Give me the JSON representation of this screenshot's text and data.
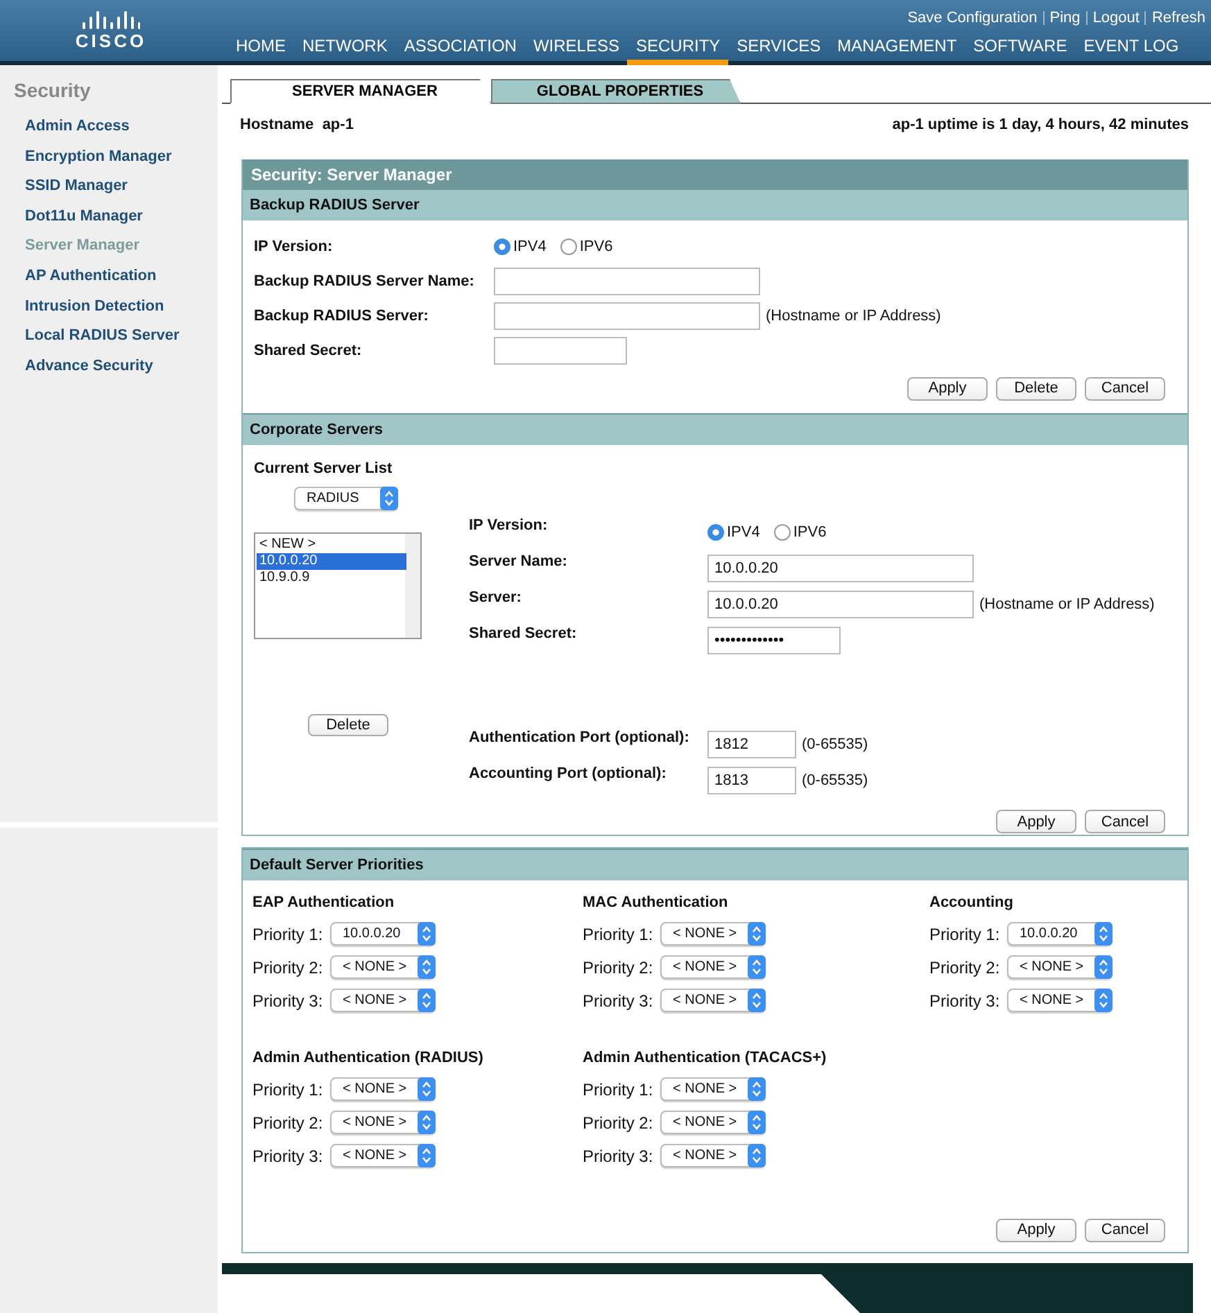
{
  "header": {
    "logo": "CISCO",
    "top_links": [
      {
        "label": "Save Configuration"
      },
      {
        "label": "Ping"
      },
      {
        "label": "Logout"
      },
      {
        "label": "Refresh"
      }
    ],
    "nav": [
      {
        "label": "HOME",
        "selected": false
      },
      {
        "label": "NETWORK",
        "selected": false
      },
      {
        "label": "ASSOCIATION",
        "selected": false
      },
      {
        "label": "WIRELESS",
        "selected": false
      },
      {
        "label": "SECURITY",
        "selected": true
      },
      {
        "label": "SERVICES",
        "selected": false
      },
      {
        "label": "MANAGEMENT",
        "selected": false
      },
      {
        "label": "SOFTWARE",
        "selected": false
      },
      {
        "label": "EVENT LOG",
        "selected": false
      }
    ]
  },
  "sidebar": {
    "title": "Security",
    "items": [
      {
        "label": "Admin Access",
        "selected": false
      },
      {
        "label": "Encryption Manager",
        "selected": false
      },
      {
        "label": "SSID Manager",
        "selected": false
      },
      {
        "label": "Dot11u Manager",
        "selected": false
      },
      {
        "label": "Server Manager",
        "selected": true
      },
      {
        "label": "AP Authentication",
        "selected": false
      },
      {
        "label": "Intrusion Detection",
        "selected": false
      },
      {
        "label": "Local RADIUS Server",
        "selected": false
      },
      {
        "label": "Advance Security",
        "selected": false
      }
    ]
  },
  "tabs": [
    {
      "label": "SERVER MANAGER",
      "selected": true
    },
    {
      "label": "GLOBAL PROPERTIES",
      "selected": false
    }
  ],
  "hostname": {
    "label": "Hostname",
    "value": "ap-1"
  },
  "uptime": "ap-1 uptime is 1 day, 4 hours, 42 minutes",
  "page_title": "Security: Server Manager",
  "backup": {
    "title": "Backup RADIUS Server",
    "ip_version": {
      "label": "IP Version:",
      "options": [
        {
          "label": "IPV4",
          "selected": true
        },
        {
          "label": "IPV6",
          "selected": false
        }
      ]
    },
    "fields": [
      {
        "label": "Backup RADIUS Server Name:",
        "kind": "wide"
      },
      {
        "label": "Backup RADIUS Server:",
        "kind": "wide",
        "hint": "(Hostname or IP Address)"
      },
      {
        "label": "Shared Secret:",
        "kind": "narrow"
      }
    ],
    "buttons": [
      "Apply",
      "Delete",
      "Cancel"
    ]
  },
  "corporate": {
    "title": "Corporate Servers",
    "list_label": "Current Server List",
    "server_type": "RADIUS",
    "servers": [
      {
        "label": "< NEW >",
        "selected": false
      },
      {
        "label": "10.0.0.20",
        "selected": true
      },
      {
        "label": "10.9.0.9",
        "selected": false
      }
    ],
    "delete_button": "Delete",
    "ip_version": {
      "label": "IP Version:",
      "options": [
        {
          "label": "IPV4",
          "selected": true
        },
        {
          "label": "IPV6",
          "selected": false
        }
      ]
    },
    "fields": [
      {
        "label": "Server Name:",
        "value": "10.0.0.20",
        "kind": "wide"
      },
      {
        "label": "Server:",
        "value": "10.0.0.20",
        "kind": "wide",
        "hint": "(Hostname or IP Address)"
      },
      {
        "label": "Shared Secret:",
        "value": "•••••••••••••",
        "kind": "narrow"
      }
    ],
    "ports": [
      {
        "label": "Authentication Port (optional):",
        "value": "1812",
        "hint": "(0-65535)"
      },
      {
        "label": "Accounting Port (optional):",
        "value": "1813",
        "hint": "(0-65535)"
      }
    ],
    "buttons": [
      "Apply",
      "Cancel"
    ]
  },
  "priorities": {
    "title": "Default Server Priorities",
    "groups": [
      {
        "title": "EAP Authentication",
        "rows": [
          {
            "label": "Priority 1:",
            "value": "10.0.0.20"
          },
          {
            "label": "Priority 2:",
            "value": "< NONE >"
          },
          {
            "label": "Priority 3:",
            "value": "< NONE >"
          }
        ]
      },
      {
        "title": "MAC Authentication",
        "rows": [
          {
            "label": "Priority 1:",
            "value": "< NONE >"
          },
          {
            "label": "Priority 2:",
            "value": "< NONE >"
          },
          {
            "label": "Priority 3:",
            "value": "< NONE >"
          }
        ]
      },
      {
        "title": "Accounting",
        "rows": [
          {
            "label": "Priority 1:",
            "value": "10.0.0.20"
          },
          {
            "label": "Priority 2:",
            "value": "< NONE >"
          },
          {
            "label": "Priority 3:",
            "value": "< NONE >"
          }
        ]
      },
      {
        "title": "Admin Authentication (RADIUS)",
        "rows": [
          {
            "label": "Priority 1:",
            "value": "< NONE >"
          },
          {
            "label": "Priority 2:",
            "value": "< NONE >"
          },
          {
            "label": "Priority 3:",
            "value": "< NONE >"
          }
        ]
      },
      {
        "title": "Admin Authentication (TACACS+)",
        "rows": [
          {
            "label": "Priority 1:",
            "value": "< NONE >"
          },
          {
            "label": "Priority 2:",
            "value": "< NONE >"
          },
          {
            "label": "Priority 3:",
            "value": "< NONE >"
          }
        ]
      }
    ],
    "buttons": [
      "Apply",
      "Cancel"
    ]
  }
}
